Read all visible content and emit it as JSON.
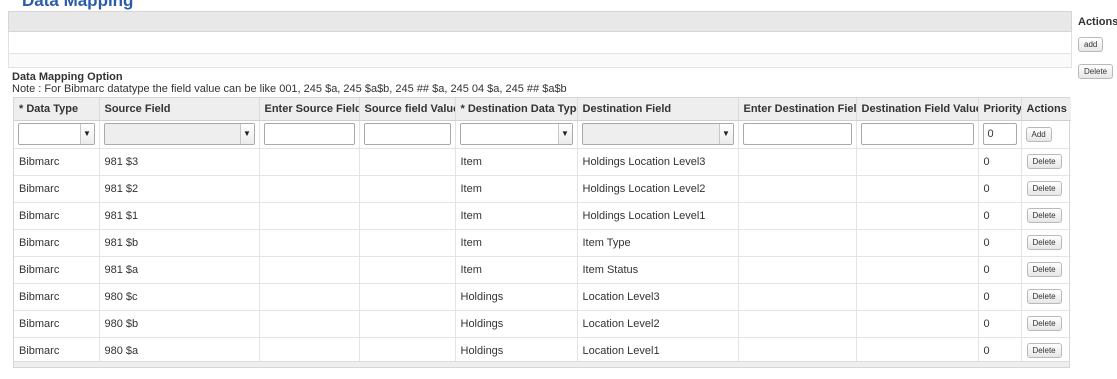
{
  "page": {
    "heading": "Data Mapping"
  },
  "actions_column": {
    "header": "Actions",
    "add_label": "add",
    "delete_label": "Delete"
  },
  "option": {
    "title": "Data Mapping Option",
    "note": "Note : For Bibmarc datatype the field value can be like 001, 245 $a, 245 $a$b, 245 ## $a, 245 04 $a, 245 ## $a$b"
  },
  "grid": {
    "columns": [
      "* Data Type",
      "Source Field",
      "Enter Source Field",
      "Source field Value",
      "* Destination Data Type",
      "Destination Field",
      "Enter Destination Field",
      "Destination Field Value",
      "Priority",
      "Actions"
    ],
    "input_row": {
      "priority_value": "0",
      "add_label": "Add"
    },
    "rows": [
      {
        "data_type": "Bibmarc",
        "source_field": "981 $3",
        "enter_source_field": "",
        "source_field_value": "",
        "destination_data_type": "Item",
        "destination_field": "Holdings Location Level3",
        "enter_destination_field": "",
        "destination_field_value": "",
        "priority": "0",
        "action_label": "Delete"
      },
      {
        "data_type": "Bibmarc",
        "source_field": "981 $2",
        "enter_source_field": "",
        "source_field_value": "",
        "destination_data_type": "Item",
        "destination_field": "Holdings Location Level2",
        "enter_destination_field": "",
        "destination_field_value": "",
        "priority": "0",
        "action_label": "Delete"
      },
      {
        "data_type": "Bibmarc",
        "source_field": "981 $1",
        "enter_source_field": "",
        "source_field_value": "",
        "destination_data_type": "Item",
        "destination_field": "Holdings Location Level1",
        "enter_destination_field": "",
        "destination_field_value": "",
        "priority": "0",
        "action_label": "Delete"
      },
      {
        "data_type": "Bibmarc",
        "source_field": "981 $b",
        "enter_source_field": "",
        "source_field_value": "",
        "destination_data_type": "Item",
        "destination_field": "Item Type",
        "enter_destination_field": "",
        "destination_field_value": "",
        "priority": "0",
        "action_label": "Delete"
      },
      {
        "data_type": "Bibmarc",
        "source_field": "981 $a",
        "enter_source_field": "",
        "source_field_value": "",
        "destination_data_type": "Item",
        "destination_field": "Item Status",
        "enter_destination_field": "",
        "destination_field_value": "",
        "priority": "0",
        "action_label": "Delete"
      },
      {
        "data_type": "Bibmarc",
        "source_field": "980 $c",
        "enter_source_field": "",
        "source_field_value": "",
        "destination_data_type": "Holdings",
        "destination_field": "Location Level3",
        "enter_destination_field": "",
        "destination_field_value": "",
        "priority": "0",
        "action_label": "Delete"
      },
      {
        "data_type": "Bibmarc",
        "source_field": "980 $b",
        "enter_source_field": "",
        "source_field_value": "",
        "destination_data_type": "Holdings",
        "destination_field": "Location Level2",
        "enter_destination_field": "",
        "destination_field_value": "",
        "priority": "0",
        "action_label": "Delete"
      },
      {
        "data_type": "Bibmarc",
        "source_field": "980 $a",
        "enter_source_field": "",
        "source_field_value": "",
        "destination_data_type": "Holdings",
        "destination_field": "Location Level1",
        "enter_destination_field": "",
        "destination_field_value": "",
        "priority": "0",
        "action_label": "Delete"
      }
    ]
  },
  "icons": {
    "dropdown_caret": "chevron-down-icon"
  },
  "colors": {
    "heading": "#2a5da8",
    "header_bg": "#eeeeee",
    "bar_bg": "#e8e8e8"
  }
}
